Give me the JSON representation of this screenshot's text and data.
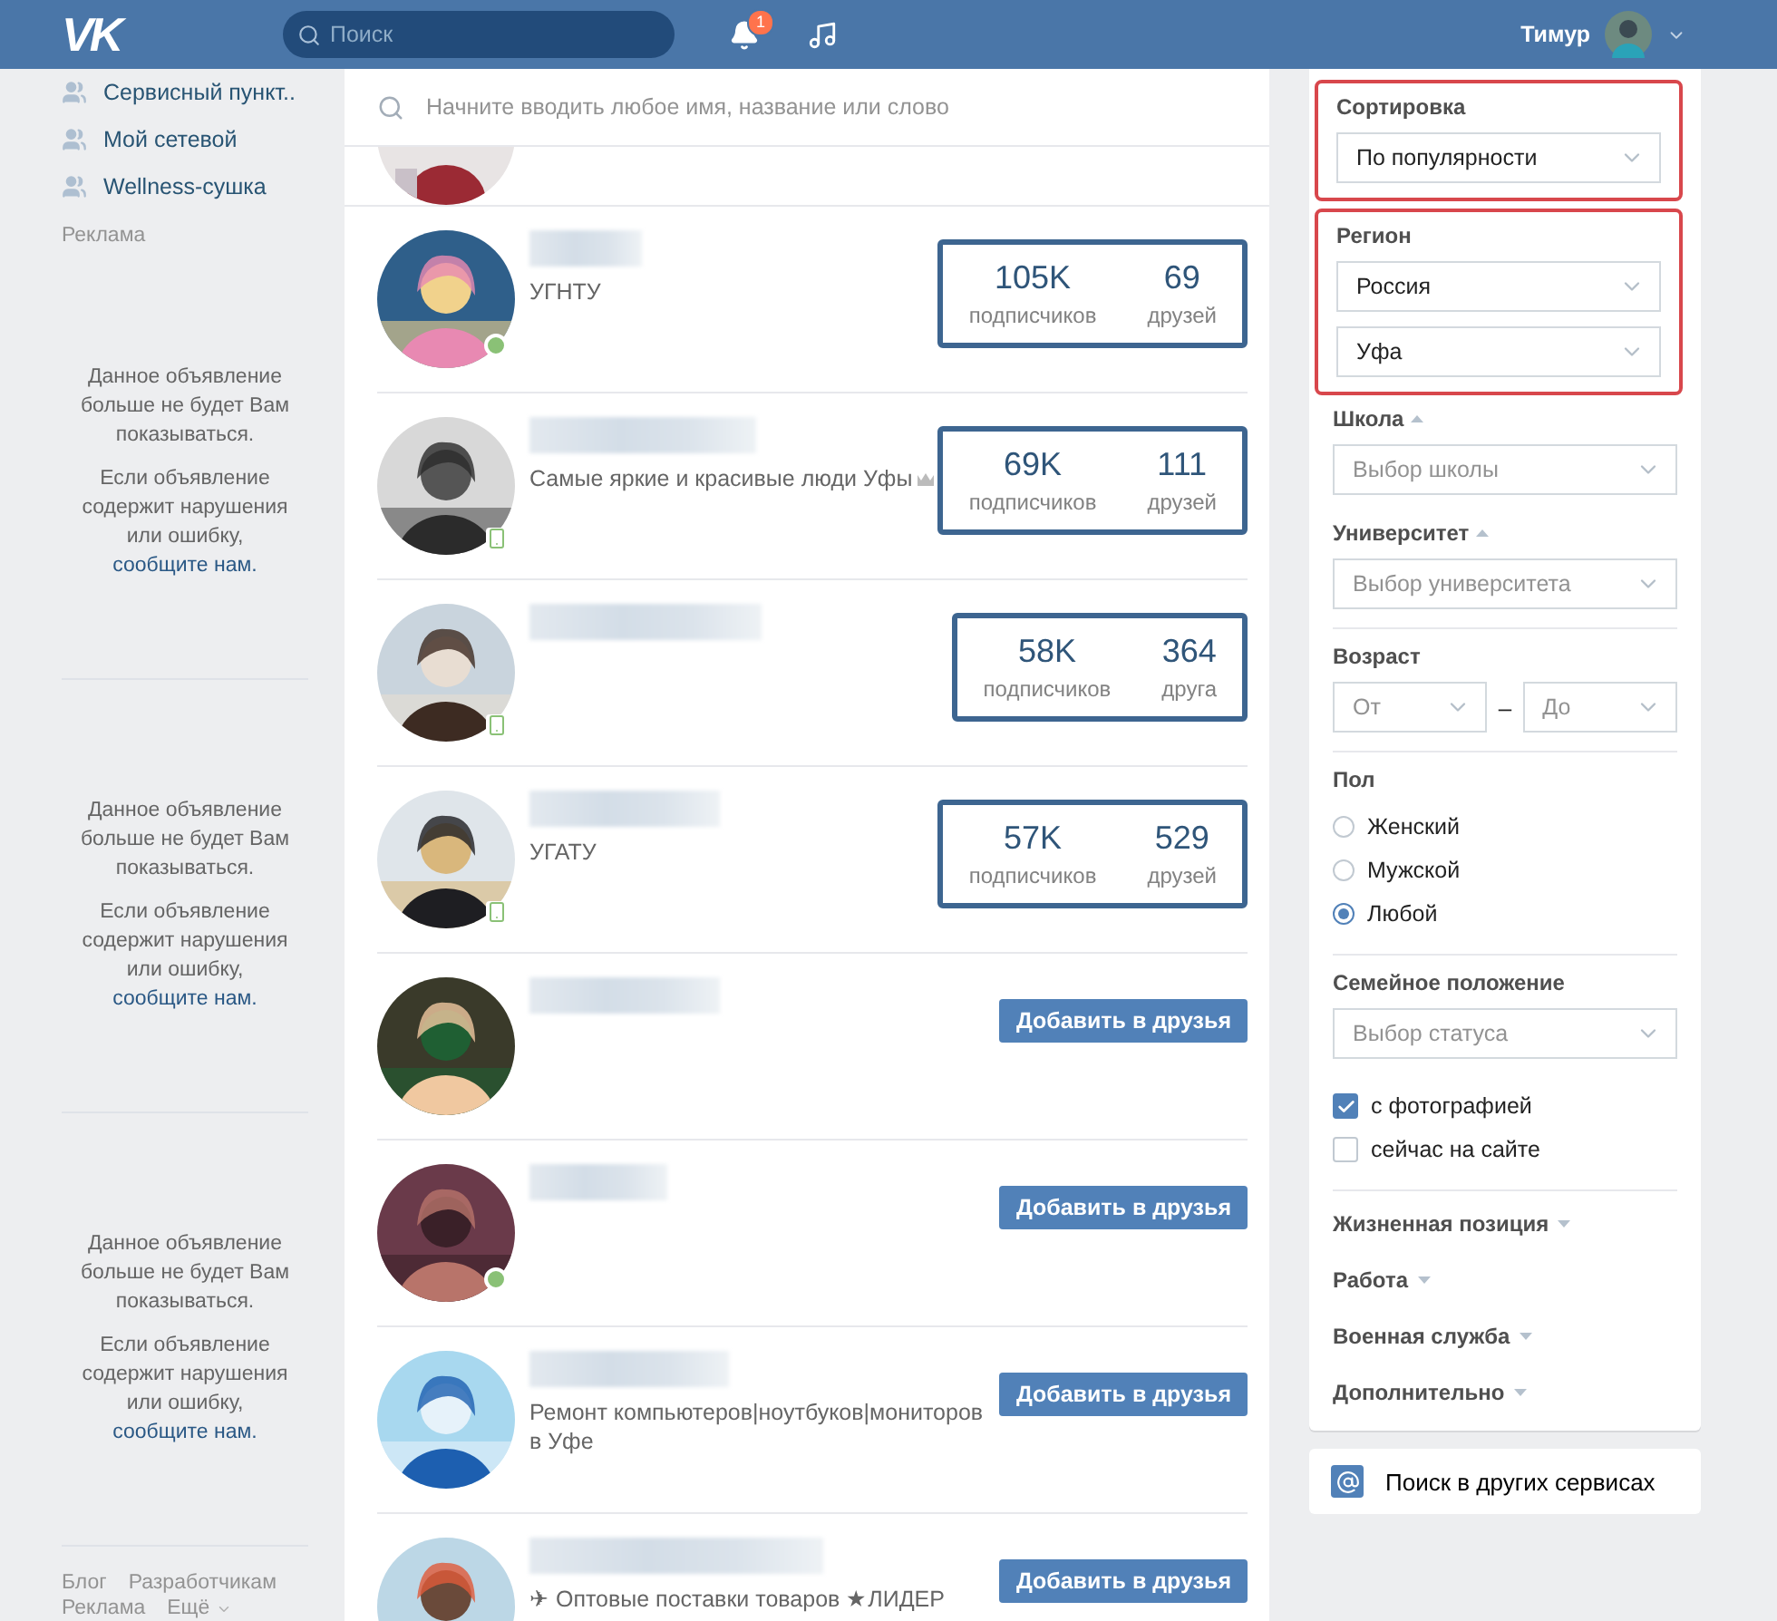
{
  "header": {
    "logo": "VK",
    "search": {
      "placeholder": "Поиск"
    },
    "notifications": {
      "badge": "1"
    },
    "user": {
      "name": "Тимур"
    }
  },
  "sidebar": {
    "items": [
      {
        "label": "Сервисный пункт.."
      },
      {
        "label": "Мой сетевой"
      },
      {
        "label": "Wellness-сушка"
      }
    ],
    "ads_label": "Реклама",
    "ads": [
      {
        "notice": "Данное объявление больше не будет Вам показываться.",
        "report_text": "Если объявление содержит нарушения или ошибку,",
        "report_link": "сообщите нам."
      },
      {
        "notice": "Данное объявление больше не будет Вам показываться.",
        "report_text": "Если объявление содержит нарушения или ошибку,",
        "report_link": "сообщите нам."
      },
      {
        "notice": "Данное объявление больше не будет Вам показываться.",
        "report_text": "Если объявление содержит нарушения или ошибку,",
        "report_link": "сообщите нам."
      }
    ],
    "footer": [
      {
        "label": "Блог",
        "kind": "link"
      },
      {
        "label": "Разработчикам",
        "kind": "link"
      },
      {
        "label": "Реклама",
        "kind": "link"
      },
      {
        "label": "Ещё",
        "kind": "menu"
      }
    ]
  },
  "results": {
    "search": {
      "placeholder": "Начните вводить любое имя, название или слово"
    },
    "rows": [
      {
        "kind": "stats",
        "subtitle": "УГНТУ",
        "online": true,
        "mobile": false,
        "stats": {
          "highlighted": true,
          "items": [
            {
              "value": "105K",
              "label": "подписчиков"
            },
            {
              "value": "69",
              "label": "друзей"
            }
          ]
        }
      },
      {
        "kind": "stats",
        "subtitle": "Самые яркие и красивые люди Уфы",
        "crown": true,
        "online": true,
        "mobile": true,
        "stats": {
          "highlighted": true,
          "items": [
            {
              "value": "69K",
              "label": "подписчиков"
            },
            {
              "value": "111",
              "label": "друзей"
            }
          ]
        }
      },
      {
        "kind": "stats",
        "online": true,
        "mobile": true,
        "stats": {
          "highlighted": true,
          "items": [
            {
              "value": "58K",
              "label": "подписчиков"
            },
            {
              "value": "364",
              "label": "друга"
            }
          ]
        }
      },
      {
        "kind": "stats",
        "subtitle": "УГАТУ",
        "online": true,
        "mobile": true,
        "stats": {
          "highlighted": true,
          "items": [
            {
              "value": "57K",
              "label": "подписчиков"
            },
            {
              "value": "529",
              "label": "друзей"
            }
          ]
        }
      },
      {
        "kind": "add",
        "online": false,
        "button": "Добавить в друзья"
      },
      {
        "kind": "add",
        "online": true,
        "mobile": false,
        "button": "Добавить в друзья"
      },
      {
        "kind": "add",
        "subtitle": "Ремонт компьютеров|ноутбуков|мониторов в Уфе",
        "online": false,
        "button": "Добавить в друзья"
      },
      {
        "kind": "add",
        "subtitle": "✈ Оптовые поставки товаров ★ЛИДЕР",
        "online": false,
        "button": "Добавить в друзья"
      }
    ]
  },
  "filters": {
    "sections": [
      {
        "kind": "select",
        "label": "Сортировка",
        "highlighted": true,
        "selects": [
          {
            "value": "По популярности"
          }
        ]
      },
      {
        "kind": "select",
        "label": "Регион",
        "highlighted": true,
        "selects": [
          {
            "value": "Россия"
          },
          {
            "value": "Уфа"
          }
        ]
      },
      {
        "kind": "select",
        "label": "Школа",
        "expanded": true,
        "selects": [
          {
            "placeholder": "Выбор школы"
          }
        ]
      },
      {
        "kind": "select",
        "label": "Университет",
        "expanded": true,
        "divider": true,
        "selects": [
          {
            "placeholder": "Выбор университета"
          }
        ]
      },
      {
        "kind": "range",
        "label": "Возраст",
        "divider": true,
        "from": {
          "placeholder": "От"
        },
        "dash": "–",
        "to": {
          "placeholder": "До"
        }
      },
      {
        "kind": "radio",
        "label": "Пол",
        "divider": true,
        "options": [
          {
            "label": "Женский",
            "selected": false
          },
          {
            "label": "Мужской",
            "selected": false
          },
          {
            "label": "Любой",
            "selected": true
          }
        ]
      },
      {
        "kind": "select",
        "label": "Семейное положение",
        "selects": [
          {
            "placeholder": "Выбор статуса"
          }
        ]
      },
      {
        "kind": "checks",
        "divider": true,
        "items": [
          {
            "label": "с фотографией",
            "checked": true
          },
          {
            "label": "сейчас на сайте",
            "checked": false
          }
        ]
      },
      {
        "kind": "toggle",
        "label": "Жизненная позиция",
        "expanded": false
      },
      {
        "kind": "toggle",
        "label": "Работа",
        "expanded": false
      },
      {
        "kind": "toggle",
        "label": "Военная служба",
        "expanded": false
      },
      {
        "kind": "toggle",
        "label": "Дополнительно",
        "expanded": false
      }
    ]
  },
  "other_services": {
    "label": "Поиск в других сервисах"
  }
}
